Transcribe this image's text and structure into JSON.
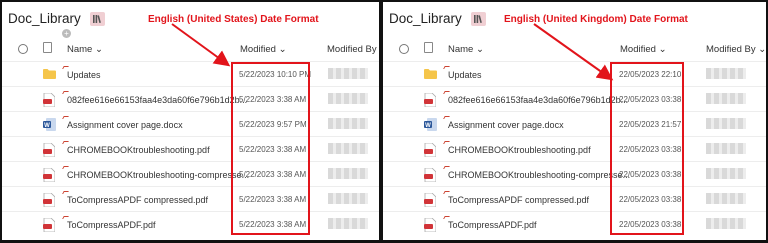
{
  "colors": {
    "annotation": "#e2141b",
    "folder": "#f5c54a",
    "pdf": "#d13438",
    "word": "#2b579a"
  },
  "icons": {
    "library": "library-icon",
    "add": "add-icon",
    "folder": "folder-icon",
    "pdf": "pdf-icon",
    "word": "word-icon",
    "select": "select-all-icon",
    "file": "file-type-icon",
    "chevron": "chevron-down-icon"
  },
  "panels": [
    {
      "library_title": "Doc_Library",
      "annotation": "English (United States) Date Format",
      "headers": {
        "name": "Name",
        "modified": "Modified",
        "modified_by": "Modified By"
      },
      "chevron": "⌄",
      "add": "+",
      "rows": [
        {
          "type": "folder",
          "name": "Updates",
          "modified": "5/22/2023 10:10 PM"
        },
        {
          "type": "pdf",
          "name": "082fee616e66153faa4e3da60f6e796b1d2b...",
          "modified": "5/22/2023 3:38 AM"
        },
        {
          "type": "word",
          "name": "Assignment cover page.docx",
          "modified": "5/22/2023 9:57 PM"
        },
        {
          "type": "pdf",
          "name": "CHROMEBOOKtroubleshooting.pdf",
          "modified": "5/22/2023 3:38 AM"
        },
        {
          "type": "pdf",
          "name": "CHROMEBOOKtroubleshooting-compresse...",
          "modified": "5/22/2023 3:38 AM"
        },
        {
          "type": "pdf",
          "name": "ToCompressAPDF compressed.pdf",
          "modified": "5/22/2023 3:38 AM"
        },
        {
          "type": "pdf",
          "name": "ToCompressAPDF.pdf",
          "modified": "5/22/2023 3:38 AM"
        }
      ]
    },
    {
      "library_title": "Doc_Library",
      "annotation": "English (United Kingdom) Date Format",
      "headers": {
        "name": "Name",
        "modified": "Modified",
        "modified_by": "Modified By"
      },
      "chevron": "⌄",
      "rows": [
        {
          "type": "folder",
          "name": "Updates",
          "modified": "22/05/2023 22:10"
        },
        {
          "type": "pdf",
          "name": "082fee616e66153faa4e3da60f6e796b1d2b...",
          "modified": "22/05/2023 03:38"
        },
        {
          "type": "word",
          "name": "Assignment cover page.docx",
          "modified": "22/05/2023 21:57"
        },
        {
          "type": "pdf",
          "name": "CHROMEBOOKtroubleshooting.pdf",
          "modified": "22/05/2023 03:38"
        },
        {
          "type": "pdf",
          "name": "CHROMEBOOKtroubleshooting-compresse...",
          "modified": "22/05/2023 03:38"
        },
        {
          "type": "pdf",
          "name": "ToCompressAPDF compressed.pdf",
          "modified": "22/05/2023 03:38"
        },
        {
          "type": "pdf",
          "name": "ToCompressAPDF.pdf",
          "modified": "22/05/2023 03:38"
        }
      ]
    }
  ]
}
